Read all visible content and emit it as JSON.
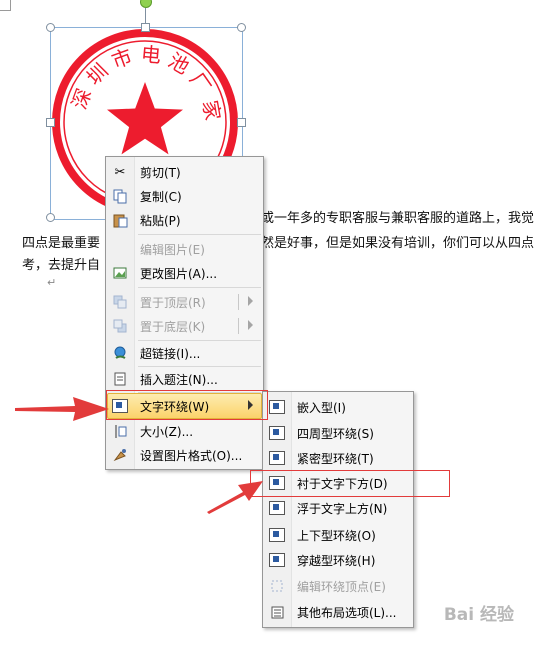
{
  "document": {
    "line1_fragment": "或一年多的专职客服与兼职客服的道路上，我觉",
    "line2_start": "四点是最重要",
    "line2_middle": "然是好事，但是如果没有培训，你们可以从四点",
    "line3_start": "考，去提升自",
    "paragraph_mark": "↵"
  },
  "seal": {
    "top_text": "深圳市电池厂家",
    "star_color": "#ed1c2e",
    "ring_color": "#ed1c2e"
  },
  "context_menu": {
    "items": [
      {
        "key": "cut",
        "label": "剪切(T)",
        "icon": "scissors-icon",
        "disabled": false
      },
      {
        "key": "copy",
        "label": "复制(C)",
        "icon": "copy-icon",
        "disabled": false
      },
      {
        "key": "paste",
        "label": "粘贴(P)",
        "icon": "paste-icon",
        "disabled": false
      },
      {
        "key": "edit_picture",
        "label": "编辑图片(E)",
        "icon": "",
        "disabled": true
      },
      {
        "key": "change_picture",
        "label": "更改图片(A)...",
        "icon": "change-picture-icon",
        "disabled": false
      },
      {
        "key": "bring_front",
        "label": "置于顶层(R)",
        "icon": "bring-front-icon",
        "disabled": true
      },
      {
        "key": "send_back",
        "label": "置于底层(K)",
        "icon": "send-back-icon",
        "disabled": true
      },
      {
        "key": "hyperlink",
        "label": "超链接(I)...",
        "icon": "hyperlink-icon",
        "disabled": false
      },
      {
        "key": "insert_caption",
        "label": "插入题注(N)...",
        "icon": "caption-icon",
        "disabled": false
      },
      {
        "key": "text_wrap",
        "label": "文字环绕(W)",
        "icon": "text-wrap-icon",
        "disabled": false
      },
      {
        "key": "size",
        "label": "大小(Z)...",
        "icon": "size-icon",
        "disabled": false
      },
      {
        "key": "format_picture",
        "label": "设置图片格式(O)...",
        "icon": "format-picture-icon",
        "disabled": false
      }
    ]
  },
  "submenu": {
    "items": [
      {
        "key": "inline",
        "label": "嵌入型(I)",
        "disabled": false
      },
      {
        "key": "square",
        "label": "四周型环绕(S)",
        "disabled": false
      },
      {
        "key": "tight",
        "label": "紧密型环绕(T)",
        "disabled": false
      },
      {
        "key": "behind",
        "label": "衬于文字下方(D)",
        "disabled": false
      },
      {
        "key": "front",
        "label": "浮于文字上方(N)",
        "disabled": false
      },
      {
        "key": "top_bottom",
        "label": "上下型环绕(O)",
        "disabled": false
      },
      {
        "key": "through",
        "label": "穿越型环绕(H)",
        "disabled": false
      },
      {
        "key": "edit_points",
        "label": "编辑环绕顶点(E)",
        "disabled": true
      },
      {
        "key": "more_layout",
        "label": "其他布局选项(L)...",
        "disabled": false
      }
    ]
  },
  "annotation": {
    "arrow_color": "#e23b3b",
    "highlight_color": "#e23b3b"
  },
  "watermark": {
    "text": "Bai 经验"
  }
}
